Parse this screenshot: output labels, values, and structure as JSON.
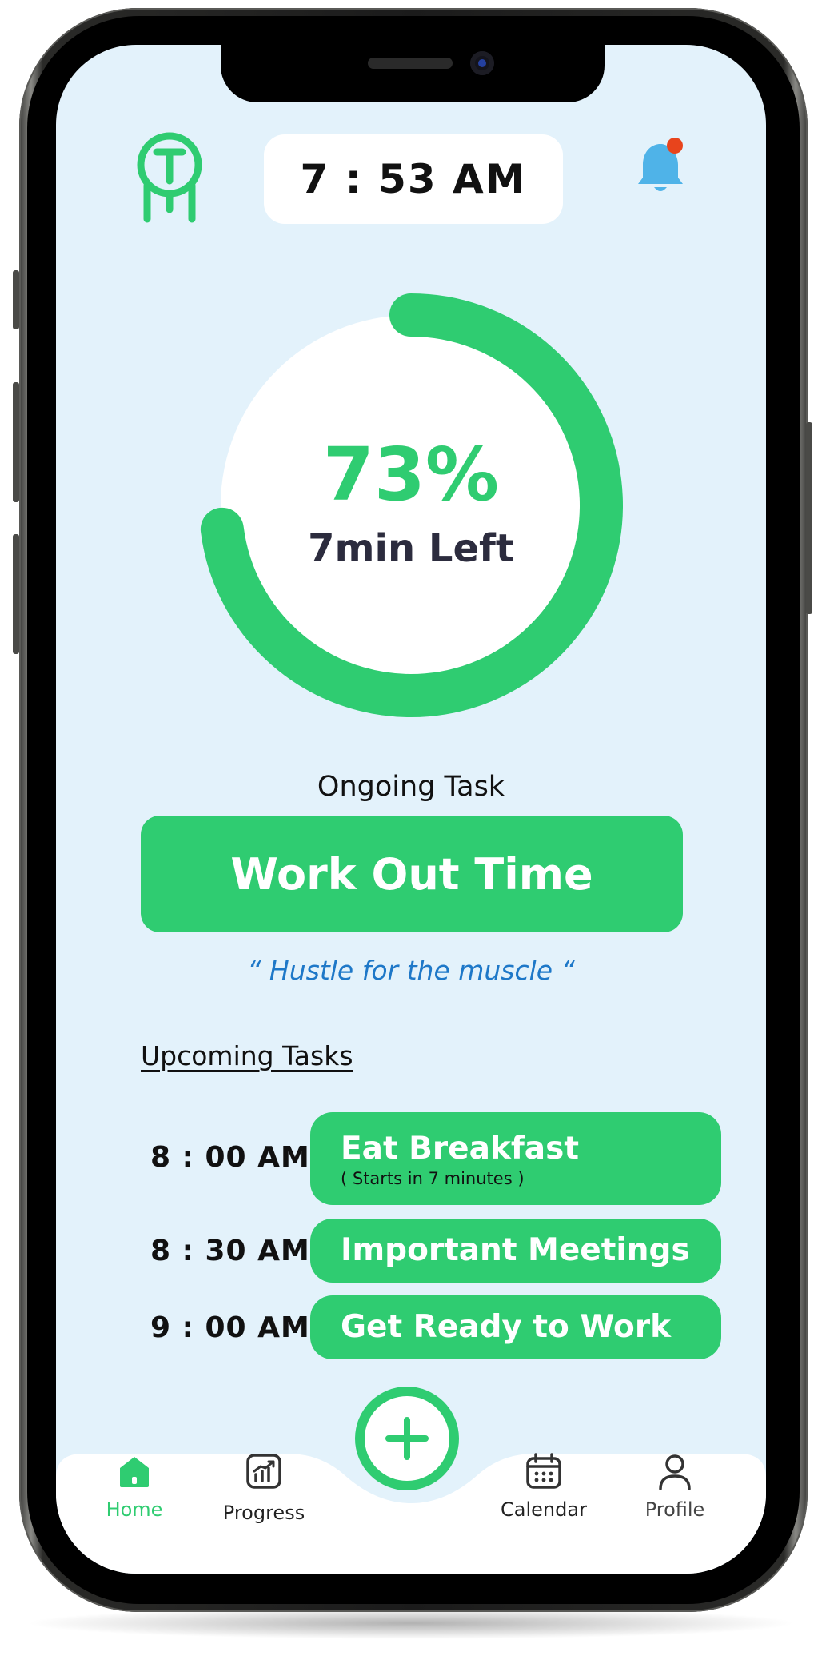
{
  "status_bar": {
    "time": "7 : 53 AM"
  },
  "progress": {
    "percent_label": "73%",
    "percent_value": 0.73,
    "remaining_label": "7min Left"
  },
  "ongoing": {
    "label": "Ongoing Task",
    "task": "Work Out Time",
    "quote": "“ Hustle for the muscle “"
  },
  "upcoming": {
    "heading": "Upcoming Tasks",
    "items": [
      {
        "time": "8 : 00 AM",
        "title": "Eat Breakfast",
        "subtitle": "( Starts in 7 minutes )"
      },
      {
        "time": "8 : 30 AM",
        "title": "Important Meetings",
        "subtitle": ""
      },
      {
        "time": "9 : 00 AM",
        "title": "Get Ready to Work",
        "subtitle": ""
      }
    ]
  },
  "nav": {
    "items": [
      {
        "label": "Home",
        "icon": "home-icon",
        "active": true
      },
      {
        "label": "Progress",
        "icon": "chart-icon",
        "active": false
      },
      {
        "label": "Calendar",
        "icon": "calendar-icon",
        "active": false
      },
      {
        "label": "Profile",
        "icon": "profile-icon",
        "active": false
      }
    ]
  },
  "colors": {
    "accent": "#2fcc71",
    "background": "#e3f2fb",
    "quote": "#1e78c8",
    "bell": "#4fb3e8",
    "badge": "#e8441c"
  }
}
